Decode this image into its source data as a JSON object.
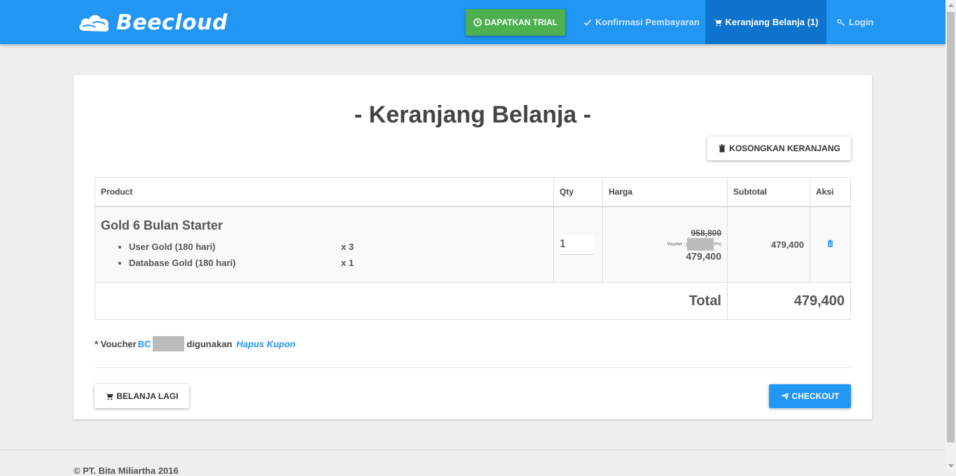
{
  "navbar": {
    "brand": "Beecloud",
    "trial_label": "DAPATKAN TRIAL",
    "konfirmasi_label": "Konfirmasi Pembayaran",
    "cart_label": "Keranjang Belanja (1)",
    "login_label": "Login",
    "color": "#2196f3",
    "active_color": "#0d73cc",
    "trial_color": "#4caf50"
  },
  "page": {
    "title": "- Keranjang Belanja -",
    "empty_cart_label": "KOSONGKAN KERANJANG",
    "shop_again_label": "BELANJA LAGI",
    "checkout_label": "CHECKOUT"
  },
  "table": {
    "headers": [
      "Product",
      "Qty",
      "Harga",
      "Subtotal",
      "Aksi"
    ],
    "items": [
      {
        "name": "Gold 6 Bulan Starter",
        "components": [
          {
            "label": "User Gold (180 hari)",
            "qty": "x 3"
          },
          {
            "label": "Database Gold (180 hari)",
            "qty": "x 1"
          }
        ],
        "qty": "1",
        "price_old": "958,800",
        "voucher_prefix": "Voucher : (",
        "voucher_suffix": "0%)",
        "price_new": "479,400",
        "subtotal": "479,400"
      }
    ],
    "total_label": "Total",
    "total_value": "479,400"
  },
  "voucher_note": {
    "prefix": "* Voucher",
    "code_visible": "BC",
    "used_text": "digunakan",
    "remove_label": "Hapus Kupon"
  },
  "footer": {
    "text": "© PT. Bita Miliartha 2016"
  }
}
